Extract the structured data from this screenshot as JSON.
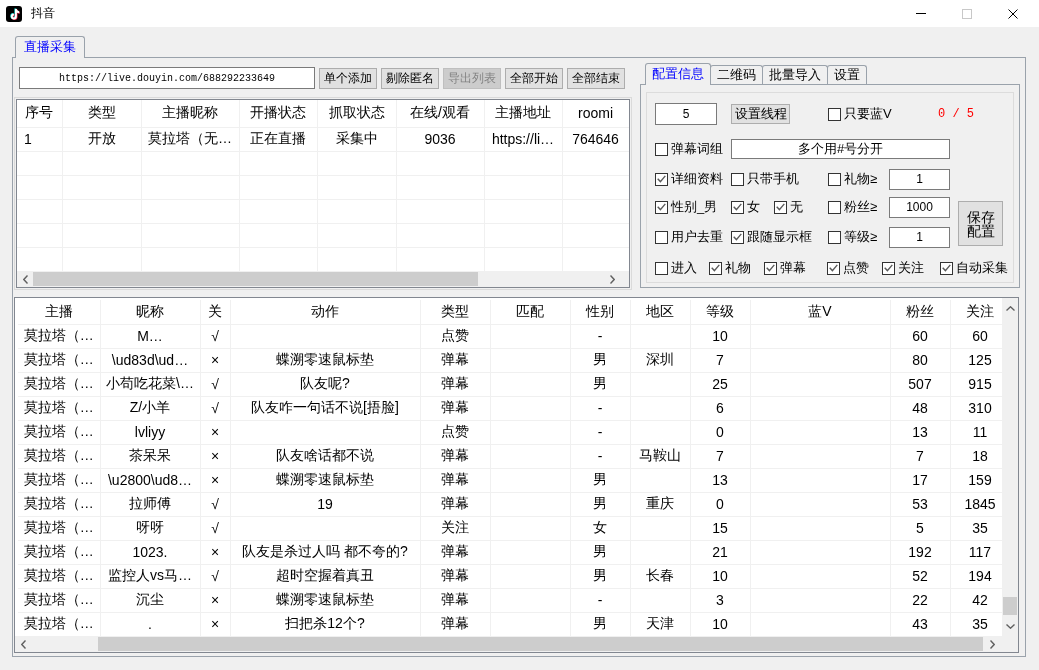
{
  "window": {
    "title": "抖音",
    "maximize_disabled": true
  },
  "main_tabs": [
    {
      "label": "直播采集",
      "selected": true
    }
  ],
  "toolbar": {
    "url_field": {
      "value": "https://live.douyin.com/688292233649"
    },
    "buttons": [
      {
        "label": "单个添加",
        "disabled": false
      },
      {
        "label": "剔除匿名",
        "disabled": false
      },
      {
        "label": "导出列表",
        "disabled": true
      },
      {
        "label": "全部开始",
        "disabled": false
      },
      {
        "label": "全部结束",
        "disabled": false
      }
    ]
  },
  "room_table": {
    "columns": [
      "序号",
      "类型",
      "主播昵称",
      "开播状态",
      "抓取状态",
      "在线/观看",
      "主播地址",
      "roomi"
    ],
    "rows": [
      [
        "1",
        "开放",
        "莫拉塔（无…",
        "正在直播",
        "采集中",
        "9036",
        "https://li…",
        "764646"
      ]
    ]
  },
  "config_tabs": [
    {
      "label": "配置信息",
      "selected": true
    },
    {
      "label": "二维码",
      "selected": false
    },
    {
      "label": "批量导入",
      "selected": false
    },
    {
      "label": "设置",
      "selected": false
    }
  ],
  "config": {
    "rows": [
      [
        {
          "kind": "input",
          "value": "5"
        },
        {
          "kind": "button",
          "label": "设置线程"
        },
        {
          "kind": "checkbox",
          "label": "只要蓝V",
          "checked": false
        },
        {
          "kind": "counter",
          "text": "0 / 5"
        }
      ],
      [
        {
          "kind": "checkbox",
          "label": "弹幕词组",
          "checked": false
        },
        {
          "kind": "input",
          "value": "多个用#号分开"
        }
      ],
      [
        {
          "kind": "checkbox",
          "label": "详细资料",
          "checked": true
        },
        {
          "kind": "checkbox",
          "label": "只带手机",
          "checked": false
        },
        {
          "kind": "checkbox",
          "label": "礼物≥",
          "checked": false
        },
        {
          "kind": "input",
          "value": "1"
        }
      ],
      [
        {
          "kind": "checkbox",
          "label": "性别_男",
          "checked": true
        },
        {
          "kind": "checkbox",
          "label": "女",
          "checked": true
        },
        {
          "kind": "checkbox",
          "label": "无",
          "checked": true
        },
        {
          "kind": "checkbox",
          "label": "粉丝≥",
          "checked": false
        },
        {
          "kind": "input",
          "value": "1000"
        }
      ],
      [
        {
          "kind": "checkbox",
          "label": "用户去重",
          "checked": false
        },
        {
          "kind": "checkbox",
          "label": "跟随显示框",
          "checked": true
        },
        {
          "kind": "checkbox",
          "label": "等级≥",
          "checked": false
        },
        {
          "kind": "input",
          "value": "1"
        }
      ],
      [
        {
          "kind": "checkbox",
          "label": "进入",
          "checked": false
        },
        {
          "kind": "checkbox",
          "label": "礼物",
          "checked": true
        },
        {
          "kind": "checkbox",
          "label": "弹幕",
          "checked": true
        },
        {
          "kind": "checkbox",
          "label": "点赞",
          "checked": true
        },
        {
          "kind": "checkbox",
          "label": "关注",
          "checked": true
        },
        {
          "kind": "checkbox",
          "label": "自动采集",
          "checked": true
        }
      ]
    ],
    "save_button": {
      "label": "保存配置"
    }
  },
  "comment_table": {
    "columns": [
      "主播",
      "昵称",
      "关",
      "动作",
      "类型",
      "匹配",
      "性别",
      "地区",
      "等级",
      "蓝V",
      "粉丝",
      "关注"
    ],
    "rows": [
      {
        "streamer": "莫拉塔（…",
        "nickname": "M…",
        "followed": "√",
        "type": "点赞",
        "gender": "-",
        "level": "10",
        "fans": "60",
        "following": "60"
      },
      {
        "streamer": "莫拉塔（…",
        "nickname": "\\ud83d\\ud…",
        "followed": "×",
        "action": "蝶溯零速鼠标垫",
        "type": "弹幕",
        "gender": "男",
        "region": "深圳",
        "level": "7",
        "fans": "80",
        "following": "125"
      },
      {
        "streamer": "莫拉塔（…",
        "nickname": "小苟吃花菜\\…",
        "followed": "√",
        "action": "队友呢?",
        "type": "弹幕",
        "gender": "男",
        "level": "25",
        "fans": "507",
        "following": "915"
      },
      {
        "streamer": "莫拉塔（…",
        "nickname": "Z/小羊",
        "followed": "√",
        "action": "队友咋一句话不说[捂脸]",
        "type": "弹幕",
        "gender": "-",
        "level": "6",
        "fans": "48",
        "following": "310"
      },
      {
        "streamer": "莫拉塔（…",
        "nickname": "lvliyy",
        "followed": "×",
        "type": "点赞",
        "gender": "-",
        "level": "0",
        "fans": "13",
        "following": "11"
      },
      {
        "streamer": "莫拉塔（…",
        "nickname": "茶呆呆",
        "followed": "×",
        "action": "队友啥话都不说",
        "type": "弹幕",
        "gender": "-",
        "region": "马鞍山",
        "level": "7",
        "fans": "7",
        "following": "18"
      },
      {
        "streamer": "莫拉塔（…",
        "nickname": "\\u2800\\ud8…",
        "followed": "×",
        "action": "蝶溯零速鼠标垫",
        "type": "弹幕",
        "gender": "男",
        "level": "13",
        "fans": "17",
        "following": "159"
      },
      {
        "streamer": "莫拉塔（…",
        "nickname": "拉师傅",
        "followed": "√",
        "action": "19",
        "type": "弹幕",
        "gender": "男",
        "region": "重庆",
        "level": "0",
        "fans": "53",
        "following": "1845"
      },
      {
        "streamer": "莫拉塔（…",
        "nickname": "呀呀",
        "followed": "√",
        "type": "关注",
        "gender": "女",
        "level": "15",
        "fans": "5",
        "following": "35"
      },
      {
        "streamer": "莫拉塔（…",
        "nickname": "1023.",
        "followed": "×",
        "action": "队友是杀过人吗 都不夸的?",
        "type": "弹幕",
        "gender": "男",
        "level": "21",
        "fans": "192",
        "following": "117"
      },
      {
        "streamer": "莫拉塔（…",
        "nickname": "监控人vs马…",
        "followed": "√",
        "action": "超时空握着真丑",
        "type": "弹幕",
        "gender": "男",
        "region": "长春",
        "level": "10",
        "fans": "52",
        "following": "194"
      },
      {
        "streamer": "莫拉塔（…",
        "nickname": "沉尘",
        "followed": "×",
        "action": "蝶溯零速鼠标垫",
        "type": "弹幕",
        "gender": "-",
        "level": "3",
        "fans": "22",
        "following": "42"
      },
      {
        "streamer": "莫拉塔（…",
        "nickname": ".",
        "followed": "×",
        "action": "扫把杀12个?",
        "type": "弹幕",
        "gender": "男",
        "region": "天津",
        "level": "10",
        "fans": "43",
        "following": "35"
      }
    ]
  }
}
